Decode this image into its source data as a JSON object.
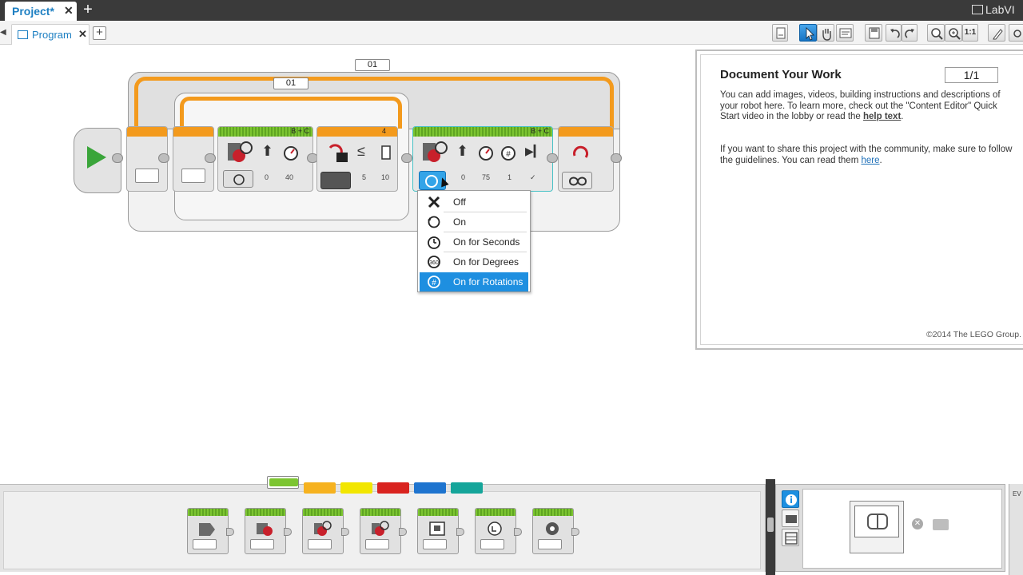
{
  "app": {
    "brand": "LabVI",
    "project_tab": "Project*",
    "program_tab": "Program"
  },
  "toolbar": {
    "zoom_1to1": "1:1"
  },
  "program": {
    "outer_loop_label": "01",
    "inner_loop_label": "01",
    "block1_ports": "B + C",
    "block1_values": [
      "0",
      "40"
    ],
    "wait_value": "4",
    "wait_params": [
      "5",
      "10"
    ],
    "block2_ports": "B + C",
    "block2_values": [
      "0",
      "75",
      "1",
      "✓"
    ]
  },
  "mode_menu": {
    "items": [
      {
        "label": "Off",
        "icon": "x-icon"
      },
      {
        "label": "On",
        "icon": "on-icon"
      },
      {
        "label": "On for Seconds",
        "icon": "timer-icon"
      },
      {
        "label": "On for Degrees",
        "icon": "degrees-icon"
      },
      {
        "label": "On for Rotations",
        "icon": "rotations-icon",
        "selected": true
      }
    ]
  },
  "doc_panel": {
    "title": "Document Your Work",
    "page": "1/1",
    "para1_a": "You can add images, videos, building instructions and descriptions of your robot here. To learn more, check out the \"Content Editor\" Quick Start video in the lobby or read the ",
    "para1_link": "help text",
    "para1_end": ".",
    "para2_a": "If you want to share this project with the community, make sure to follow the guidelines. You can read them ",
    "para2_link": "here",
    "para2_end": ".",
    "copyright": "©2014 The LEGO Group."
  },
  "palette": {
    "tab_colors": [
      "#7cc531",
      "#f6b21f",
      "#f2e600",
      "#d9231f",
      "#1e74cf",
      "#15a59a"
    ]
  },
  "colors": {
    "accent": "#1d8fe0",
    "loop_orange": "#f39a1d",
    "action_green": "#7cc531"
  }
}
